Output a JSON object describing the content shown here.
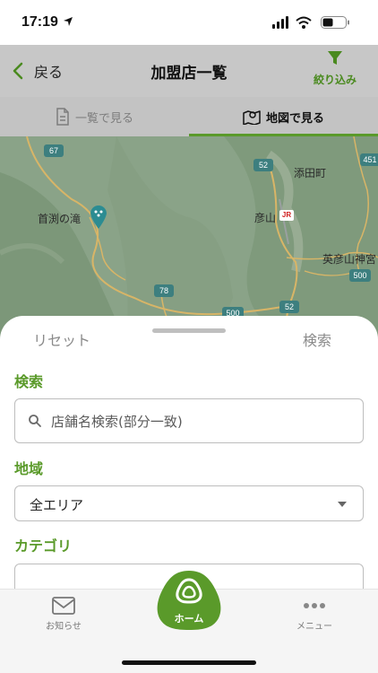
{
  "status_bar": {
    "time": "17:19",
    "icons": [
      "location-arrow-icon",
      "signal-bars-icon",
      "wifi-icon",
      "battery-icon"
    ]
  },
  "nav": {
    "back_label": "戻る",
    "title": "加盟店一覧",
    "filter_label": "絞り込み"
  },
  "tabs": [
    {
      "label": "一覧で見る",
      "icon": "document-icon",
      "active": false
    },
    {
      "label": "地図で見る",
      "icon": "map-icon",
      "active": true
    }
  ],
  "map": {
    "places": {
      "soeda": "添田町",
      "hikosan": "彦山",
      "hikosan_jingu": "英彦山神宮",
      "kubuchi": "首渕の滝"
    },
    "route_numbers": {
      "r67": "67",
      "r52_north": "52",
      "r451": "451",
      "r78": "78",
      "r500_south": "500",
      "r52_south": "52",
      "r500_east": "500"
    },
    "rail_badge": "JR"
  },
  "sheet": {
    "reset_label": "リセット",
    "search_label": "検索",
    "search_section_label": "検索",
    "search_placeholder": "店舗名検索(部分一致)",
    "area_section_label": "地域",
    "area_value": "全エリア",
    "category_section_label": "カテゴリ"
  },
  "tabbar": {
    "news_label": "お知らせ",
    "home_label": "ホーム",
    "menu_label": "メニュー"
  },
  "colors": {
    "accent_green": "#5a9a2a",
    "filter_green": "#4a8a1f",
    "nav_gray": "#c7c7c7"
  }
}
